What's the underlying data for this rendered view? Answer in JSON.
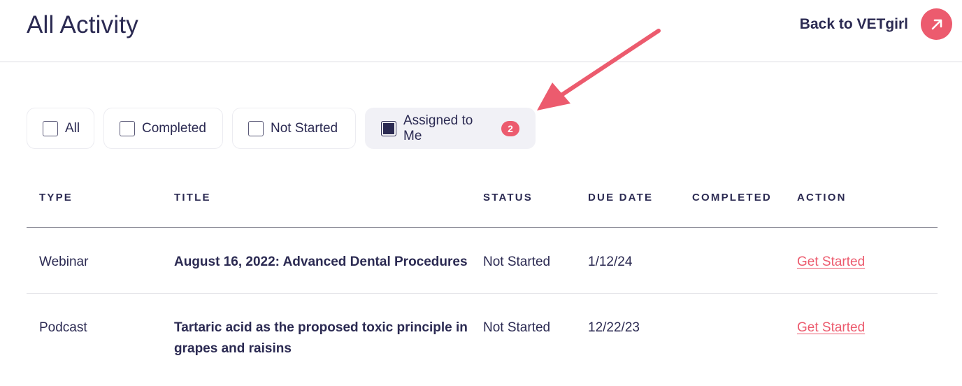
{
  "header": {
    "title": "All Activity",
    "back_label": "Back to VETgirl",
    "back_icon": "arrow-up-right-icon",
    "accent_color": "#ec5b6e"
  },
  "filters": [
    {
      "label": "All",
      "checked": false
    },
    {
      "label": "Completed",
      "checked": false
    },
    {
      "label": "Not Started",
      "checked": false
    },
    {
      "label": "Assigned to Me",
      "checked": true,
      "count": "2"
    }
  ],
  "table": {
    "columns": [
      "TYPE",
      "TITLE",
      "STATUS",
      "DUE DATE",
      "COMPLETED",
      "ACTION"
    ],
    "rows": [
      {
        "type": "Webinar",
        "title": "August 16, 2022: Advanced Dental Procedures",
        "status": "Not Started",
        "due_date": "1/12/24",
        "completed": "",
        "action": "Get Started"
      },
      {
        "type": "Podcast",
        "title": "Tartaric acid as the proposed toxic principle in grapes and raisins",
        "status": "Not Started",
        "due_date": "12/22/23",
        "completed": "",
        "action": "Get Started"
      }
    ]
  }
}
